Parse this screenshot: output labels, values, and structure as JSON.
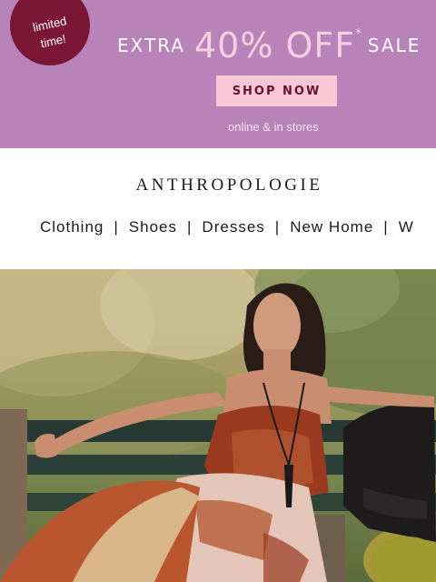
{
  "promo": {
    "badge_line1": "limited",
    "badge_line2": "time!",
    "extra": "EXTRA",
    "percent": "40% OFF",
    "asterisk": "*",
    "sale": "SALE",
    "cta": "SHOP NOW",
    "subtext": "online & in stores",
    "colors": {
      "background": "#b883b9",
      "badge": "#7a1736",
      "button": "#f7c9d7",
      "button_text": "#6b1131"
    }
  },
  "header": {
    "brand": "ANTHROPOLOGIE"
  },
  "nav": {
    "items": [
      {
        "label": "Clothing"
      },
      {
        "label": "Shoes"
      },
      {
        "label": "Dresses"
      },
      {
        "label": "New Home"
      },
      {
        "label": "W"
      }
    ],
    "separator": "|"
  }
}
